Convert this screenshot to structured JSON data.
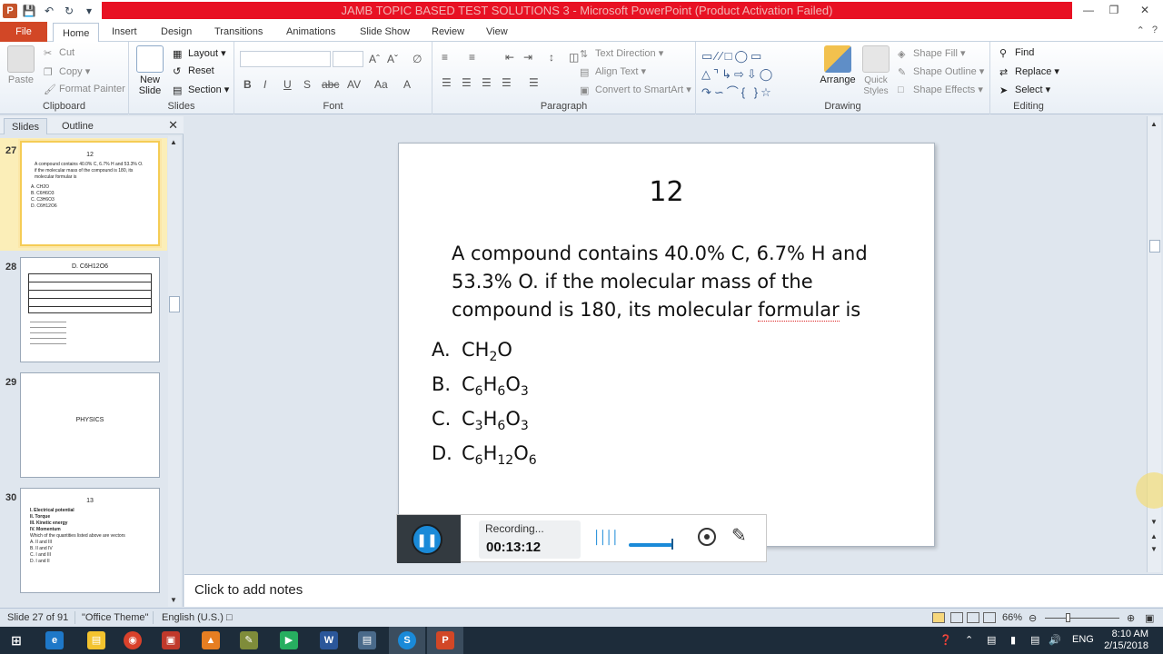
{
  "window": {
    "title": "JAMB TOPIC BASED TEST SOLUTIONS 3  -  Microsoft PowerPoint (Product Activation Failed)"
  },
  "tabs": [
    "File",
    "Home",
    "Insert",
    "Design",
    "Transitions",
    "Animations",
    "Slide Show",
    "Review",
    "View"
  ],
  "ribbon": {
    "clipboard": {
      "paste": "Paste",
      "cut": "Cut",
      "copy": "Copy",
      "format_painter": "Format Painter",
      "label": "Clipboard"
    },
    "slides": {
      "new_slide": "New Slide",
      "layout": "Layout",
      "reset": "Reset",
      "section": "Section",
      "label": "Slides"
    },
    "font": {
      "label": "Font"
    },
    "paragraph": {
      "text_direction": "Text Direction",
      "align_text": "Align Text",
      "convert_smartart": "Convert to SmartArt",
      "label": "Paragraph"
    },
    "drawing": {
      "arrange": "Arrange",
      "quick_styles": "Quick Styles",
      "shape_fill": "Shape Fill",
      "shape_outline": "Shape Outline",
      "shape_effects": "Shape Effects",
      "label": "Drawing"
    },
    "editing": {
      "find": "Find",
      "replace": "Replace",
      "select": "Select",
      "label": "Editing"
    }
  },
  "left_pane": {
    "tabs": [
      "Slides",
      "Outline"
    ],
    "thumbnails": [
      {
        "num": "27",
        "title": "12",
        "text": "A compound contains 40.0% C, 6.7% H and 53.3% O. if the molecular mass of the compound is 180, its molecular formular is",
        "opts": [
          "A.  CH2O",
          "B.  C6H6O3",
          "C.  C3H6O3",
          "D.  C6H12O6"
        ]
      },
      {
        "num": "28",
        "title": "D. C6H12O6"
      },
      {
        "num": "29",
        "center": "PHYSICS"
      },
      {
        "num": "30",
        "title": "13",
        "lines": [
          "I.   Electrical potential",
          "II.  Torque",
          "III. Kinetic energy",
          "IV. Momentum",
          "Which of the quantities listed above are vectors",
          "A.  II and III",
          "B.  II and IV",
          "C.  I and III",
          "D.  I and II"
        ]
      }
    ]
  },
  "slide": {
    "number": "12",
    "question_pre": "A compound contains 40.0% C, 6.7% H and 53.3% O. if the molecular  mass of the compound is 180, its molecular ",
    "question_squiggle": "formular",
    "question_post": " is",
    "options": [
      {
        "letter": "A.",
        "parts": [
          [
            "CH",
            ""
          ],
          [
            "2",
            "sub"
          ],
          [
            "O",
            ""
          ]
        ]
      },
      {
        "letter": "B.",
        "parts": [
          [
            "C",
            ""
          ],
          [
            "6",
            "sub"
          ],
          [
            "H",
            ""
          ],
          [
            "6",
            "sub"
          ],
          [
            "O",
            ""
          ],
          [
            "3",
            "sub"
          ]
        ]
      },
      {
        "letter": "C.",
        "parts": [
          [
            "C",
            ""
          ],
          [
            "3",
            "sub"
          ],
          [
            "H",
            ""
          ],
          [
            "6",
            "sub"
          ],
          [
            "O",
            ""
          ],
          [
            "3",
            "sub"
          ]
        ]
      },
      {
        "letter": "D.",
        "parts": [
          [
            "C",
            ""
          ],
          [
            "6",
            "sub"
          ],
          [
            "H",
            ""
          ],
          [
            "12",
            "sub"
          ],
          [
            "O",
            ""
          ],
          [
            "6",
            "sub"
          ]
        ]
      }
    ]
  },
  "recorder": {
    "status": "Recording...",
    "time": "00:13:12"
  },
  "notes": {
    "placeholder": "Click to add notes"
  },
  "status": {
    "slide": "Slide 27 of 91",
    "theme": "\"Office Theme\"",
    "language": "English (U.S.)",
    "zoom": "66%"
  },
  "taskbar": {
    "lang": "ENG",
    "time": "8:10 AM",
    "date": "2/15/2018"
  },
  "colors": {
    "accent_red": "#e81123",
    "file_tab": "#d24726",
    "recorder_blue": "#1a8ad8"
  }
}
